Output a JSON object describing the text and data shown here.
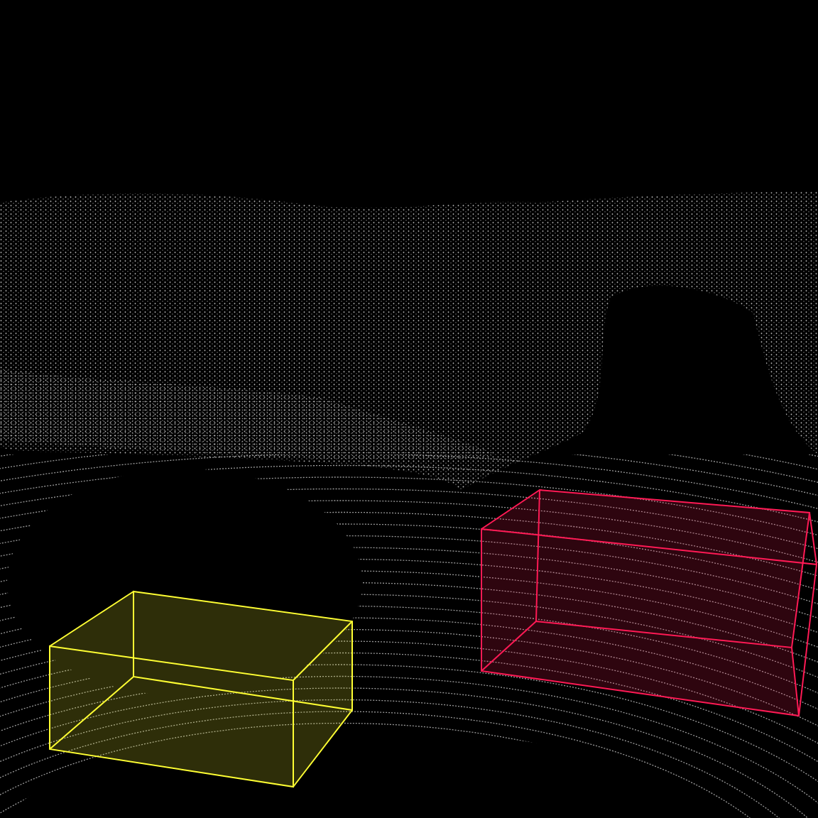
{
  "bounding_boxes": [
    {
      "color": "#ffff33"
    },
    {
      "color": "#ff1a55"
    }
  ]
}
